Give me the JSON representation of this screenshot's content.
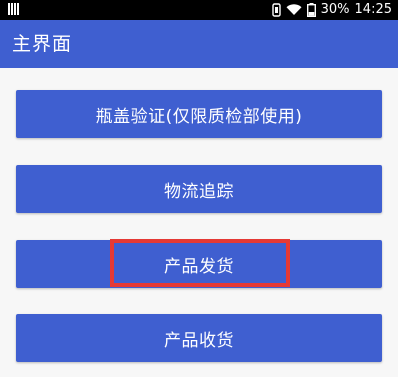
{
  "status_bar": {
    "battery": "30%",
    "time": "14:25",
    "icons": [
      "sim-card-icon",
      "vibrate-icon",
      "wifi-icon",
      "battery-icon"
    ]
  },
  "app_bar": {
    "title": "主界面"
  },
  "buttons": [
    {
      "label": "瓶盖验证(仅限质检部使用)"
    },
    {
      "label": "物流追踪"
    },
    {
      "label": "产品发货"
    },
    {
      "label": "产品收货"
    }
  ],
  "colors": {
    "primary": "#3f5fd0",
    "highlight": "#e53935",
    "status_bar": "#000000"
  }
}
